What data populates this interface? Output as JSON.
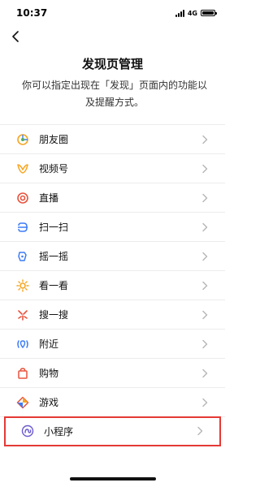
{
  "status": {
    "time": "10:37",
    "network": "4G",
    "battery_level": 1.0
  },
  "header": {
    "title": "发现页管理",
    "description": "你可以指定出现在「发现」页面内的功能以及提醒方式。"
  },
  "items": [
    {
      "label": "朋友圈",
      "icon": "moments-icon",
      "color": "#f5a623"
    },
    {
      "label": "视频号",
      "icon": "channels-icon",
      "color": "#f5a623"
    },
    {
      "label": "直播",
      "icon": "live-icon",
      "color": "#e8533d"
    },
    {
      "label": "扫一扫",
      "icon": "scan-icon",
      "color": "#3d7cf5"
    },
    {
      "label": "摇一摇",
      "icon": "shake-icon",
      "color": "#3d7cf5"
    },
    {
      "label": "看一看",
      "icon": "top-stories-icon",
      "color": "#f5a623"
    },
    {
      "label": "搜一搜",
      "icon": "search-icon",
      "color": "#e8533d"
    },
    {
      "label": "附近",
      "icon": "nearby-icon",
      "color": "#3d7cf5"
    },
    {
      "label": "购物",
      "icon": "shopping-icon",
      "color": "#e8533d"
    },
    {
      "label": "游戏",
      "icon": "games-icon",
      "color": "#e8533d"
    },
    {
      "label": "小程序",
      "icon": "mini-programs-icon",
      "color": "#6a5acd",
      "selected": true
    }
  ]
}
